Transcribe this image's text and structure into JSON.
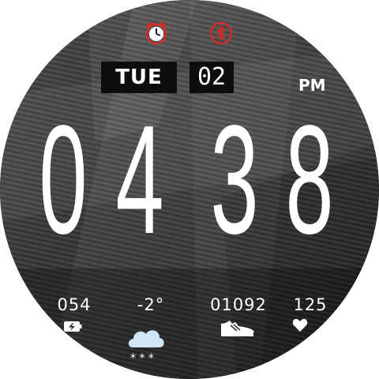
{
  "status_icons": {
    "alarm": "alarm-clock-icon",
    "bluetooth": "bluetooth-icon"
  },
  "date": {
    "weekday": "TUE",
    "day": "02"
  },
  "time": {
    "h1": "0",
    "h2": "4",
    "m1": "3",
    "m2": "8",
    "ampm": "PM"
  },
  "stats": {
    "battery": "054",
    "temperature": "-2°",
    "steps": "01092",
    "heart_rate": "125"
  },
  "colors": {
    "alert_red": "#d42a2a",
    "text": "#ffffff",
    "date_box": "#0d0d0d"
  }
}
